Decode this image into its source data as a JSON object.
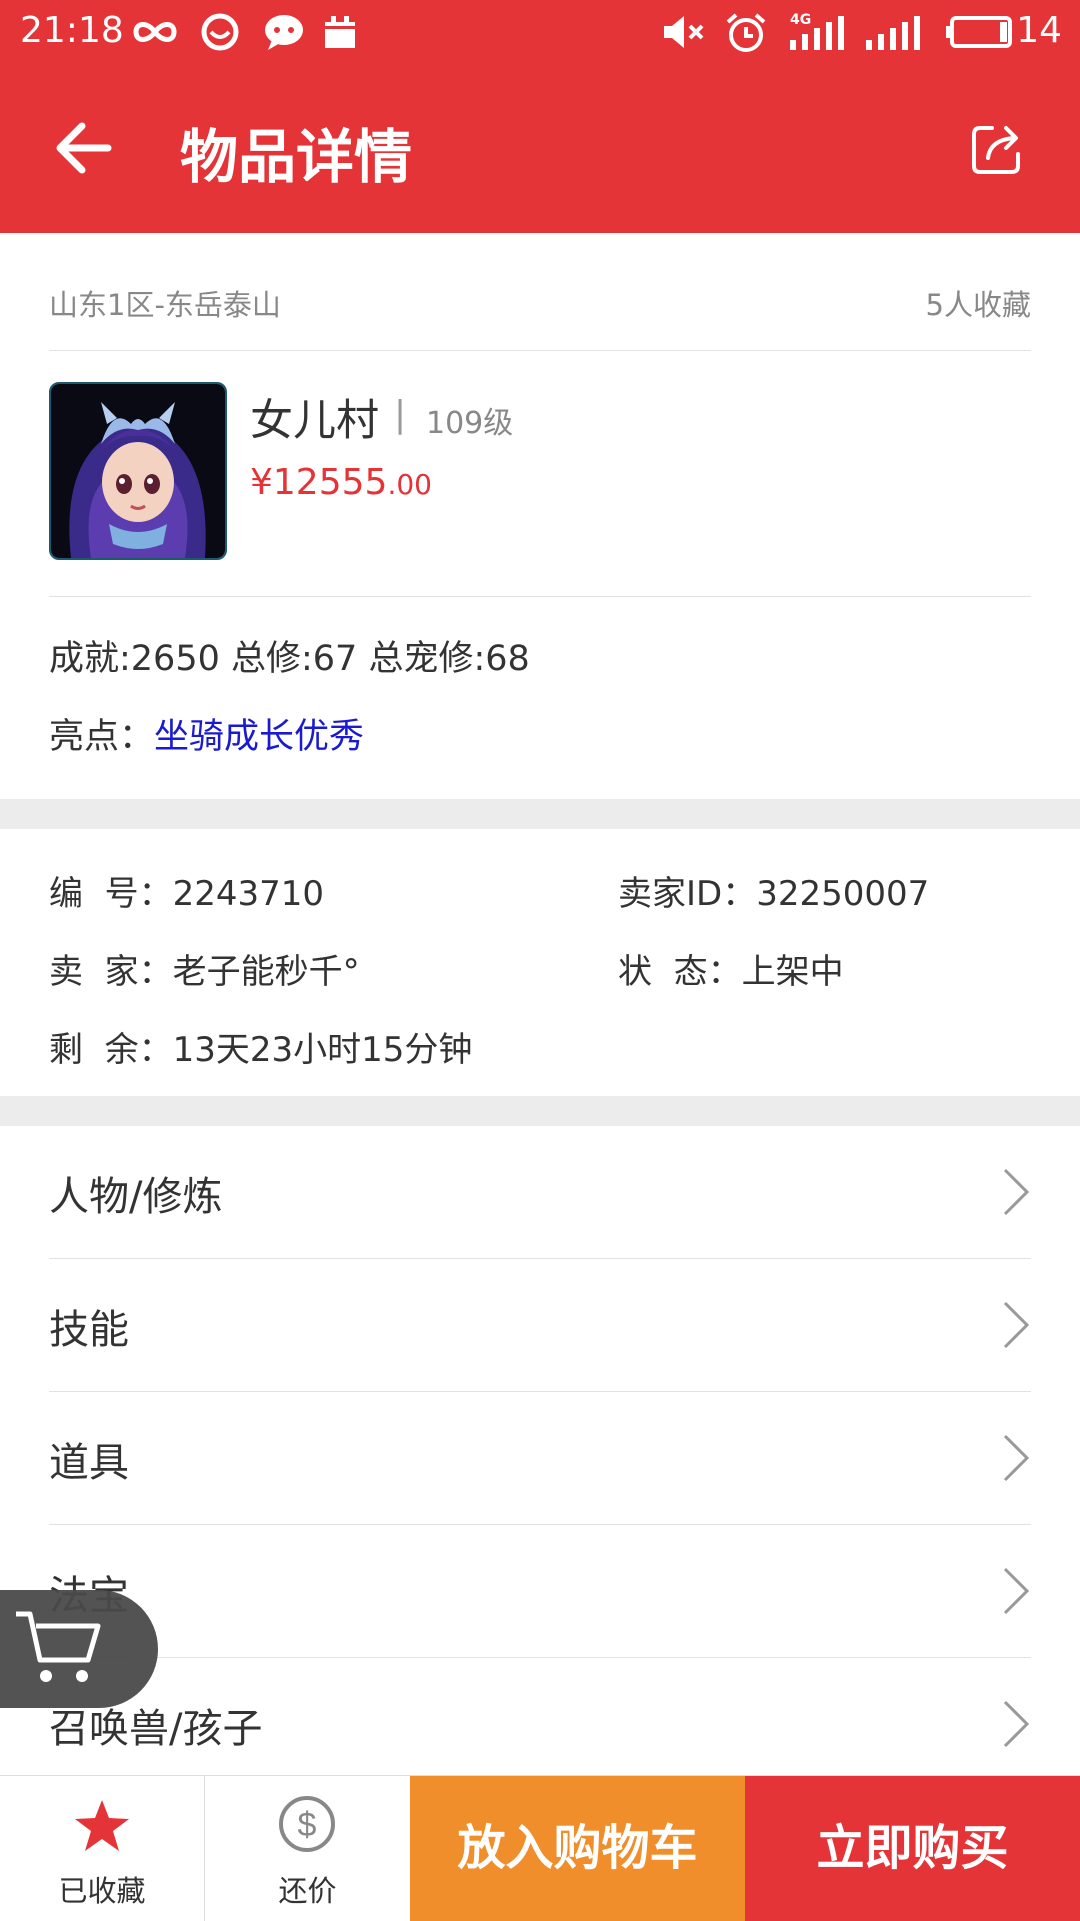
{
  "status_bar": {
    "time": "21:18",
    "network": "4G",
    "battery": "14",
    "icons": [
      "infinity-icon",
      "smiley-icon",
      "chat-bubble-icon",
      "calendar-icon",
      "mute-icon",
      "alarm-icon",
      "signal-icon",
      "battery-icon"
    ]
  },
  "app_bar": {
    "title": "物品详情",
    "back_icon": "back-arrow-icon",
    "share_icon": "share-icon"
  },
  "header": {
    "region": "山东1区-东岳泰山",
    "favorites": "5人收藏"
  },
  "item": {
    "name": "女儿村",
    "separator": "|",
    "level": "109级",
    "price_main": "¥12555",
    "price_decimal": ".00",
    "stats": "成就:2650 总修:67 总宠修:68",
    "highlight_label": "亮点：",
    "highlight_value": "坐骑成长优秀"
  },
  "details": {
    "id_label": "编  号：",
    "id_value": "2243710",
    "seller_id_label": "卖家ID：",
    "seller_id_value": "32250007",
    "seller_label": "卖  家：",
    "seller_value": "老子能秒千°",
    "status_label": "状  态：",
    "status_value": "上架中",
    "remaining_label": "剩  余：",
    "remaining_value": "13天23小时15分钟"
  },
  "menu": [
    {
      "label": "人物/修炼"
    },
    {
      "label": "技能"
    },
    {
      "label": "道具"
    },
    {
      "label": "法宝"
    },
    {
      "label": "召唤兽/孩子"
    }
  ],
  "bottom_bar": {
    "favorite_label": "已收藏",
    "bargain_label": "还价",
    "add_to_cart": "放入购物车",
    "buy_now": "立即购买"
  },
  "colors": {
    "brand_red": "#e43437",
    "orange": "#ef8e2b",
    "highlight_blue": "#1a1ad0"
  }
}
